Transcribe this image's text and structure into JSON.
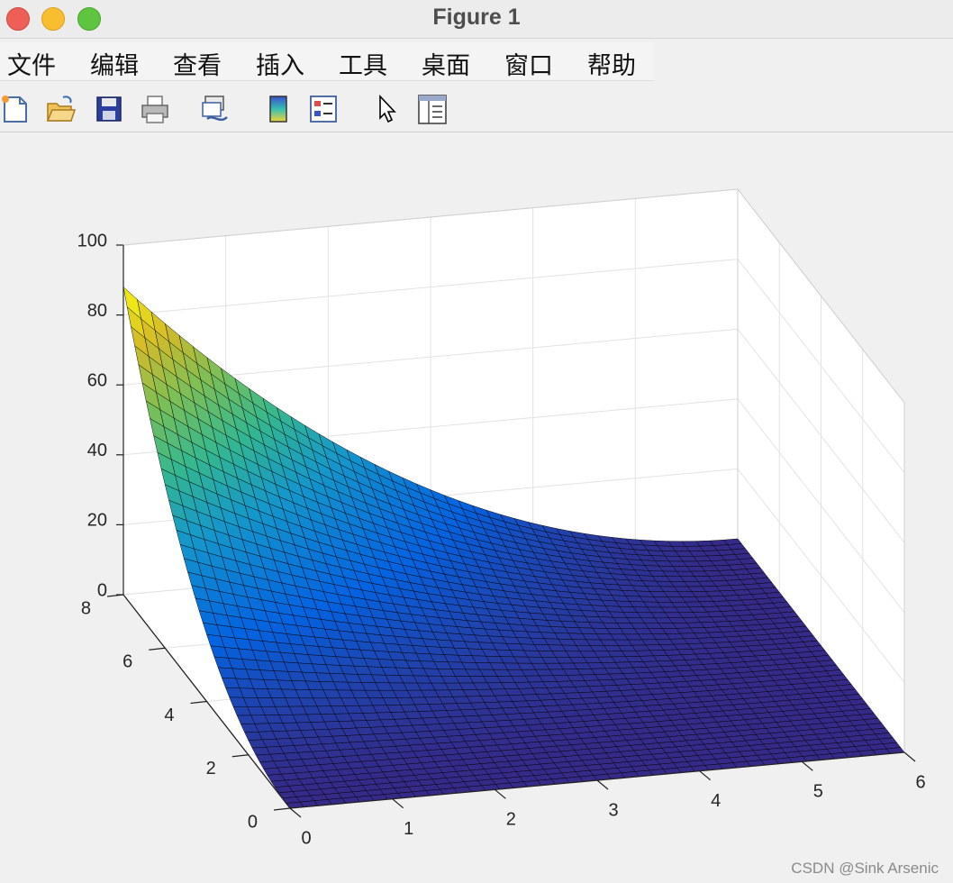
{
  "window": {
    "title": "Figure 1"
  },
  "menu": {
    "items": [
      "文件",
      "编辑",
      "查看",
      "插入",
      "工具",
      "桌面",
      "窗口",
      "帮助"
    ]
  },
  "toolbar": {
    "icons": [
      "new-figure-icon",
      "open-file-icon",
      "save-icon",
      "print-icon",
      "link-plot-icon",
      "insert-colorbar-icon",
      "insert-legend-icon",
      "edit-plot-cursor-icon",
      "property-inspector-icon"
    ]
  },
  "chart_data": {
    "type": "surface",
    "colormap": "parula",
    "grid": true,
    "box": true,
    "edge_color": "black",
    "x": {
      "ticks": [
        "0",
        "1",
        "2",
        "3",
        "4",
        "5",
        "6"
      ],
      "range": [
        0,
        6
      ]
    },
    "y": {
      "ticks": [
        "0",
        "2",
        "4",
        "6",
        "8"
      ],
      "range": [
        0,
        8
      ]
    },
    "z": {
      "ticks": [
        "0",
        "20",
        "40",
        "60",
        "80",
        "100"
      ],
      "range": [
        0,
        100
      ]
    },
    "corner_values": {
      "x0_y0": 0,
      "x6_y0": 0,
      "x0_y8": 88,
      "x6_y8": 0
    },
    "min_region": "z ≈ 0 along x ≈ 0–6 at y ≈ 0"
  },
  "watermark": "CSDN @Sink Arsenic"
}
